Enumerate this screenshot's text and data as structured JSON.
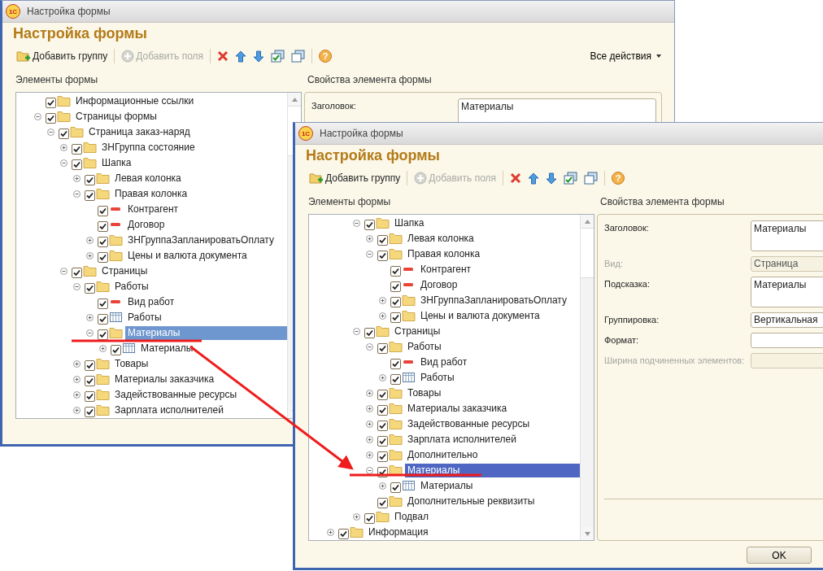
{
  "windows": [
    {
      "logo": "1С",
      "title": "Настройка формы",
      "heading": "Настройка формы",
      "focused": false,
      "toolbar": [
        [
          {
            "kind": "add-group",
            "label": "Добавить группу",
            "disabled": false
          }
        ],
        [
          {
            "kind": "add-fields",
            "label": "Добавить поля",
            "disabled": true
          }
        ],
        [
          {
            "kind": "delete"
          },
          {
            "kind": "up"
          },
          {
            "kind": "down"
          },
          {
            "kind": "check-all"
          },
          {
            "kind": "uncheck-all"
          }
        ],
        [
          {
            "kind": "help",
            "glyph": "?"
          }
        ]
      ],
      "all_actions": "Все действия",
      "tree_title": "Элементы формы",
      "tree": [
        {
          "label": "Информационные ссылки",
          "kind": "folder",
          "checked": true,
          "selected": false
        },
        {
          "label": "Страницы формы",
          "kind": "folder",
          "checked": true,
          "selected": false,
          "expanded": true,
          "children": [
            {
              "label": "Страница заказ-наряд",
              "kind": "folder",
              "checked": true,
              "selected": false,
              "expanded": true,
              "children": [
                {
                  "label": "ЗНГруппа состояние",
                  "kind": "folder",
                  "checked": true,
                  "selected": false,
                  "expanded": false
                },
                {
                  "label": "Шапка",
                  "kind": "folder",
                  "checked": true,
                  "selected": false,
                  "expanded": true,
                  "children": [
                    {
                      "label": "Левая колонка",
                      "kind": "folder",
                      "checked": true,
                      "selected": false,
                      "expanded": false
                    },
                    {
                      "label": "Правая колонка",
                      "kind": "folder",
                      "checked": true,
                      "selected": false,
                      "expanded": true,
                      "children": [
                        {
                          "label": "Контрагент",
                          "kind": "field",
                          "checked": true,
                          "selected": false
                        },
                        {
                          "label": "Договор",
                          "kind": "field",
                          "checked": true,
                          "selected": false
                        },
                        {
                          "label": "ЗНГруппаЗапланироватьОплату",
                          "kind": "folder",
                          "checked": true,
                          "selected": false,
                          "expanded": false
                        },
                        {
                          "label": "Цены и валюта документа",
                          "kind": "folder",
                          "checked": true,
                          "selected": false,
                          "expanded": false
                        }
                      ]
                    }
                  ]
                },
                {
                  "label": "Страницы",
                  "kind": "folder",
                  "checked": true,
                  "selected": false,
                  "expanded": true,
                  "children": [
                    {
                      "label": "Работы",
                      "kind": "folder",
                      "checked": true,
                      "selected": false,
                      "expanded": true,
                      "children": [
                        {
                          "label": "Вид работ",
                          "kind": "field",
                          "checked": true,
                          "selected": false
                        },
                        {
                          "label": "Работы",
                          "kind": "table",
                          "checked": true,
                          "selected": false,
                          "expanded": false
                        },
                        {
                          "label": "Материалы",
                          "kind": "folder",
                          "checked": true,
                          "selected": true,
                          "expanded": true,
                          "children": [
                            {
                              "label": "Материалы",
                              "kind": "table",
                              "checked": true,
                              "selected": false,
                              "expanded": false
                            }
                          ]
                        }
                      ]
                    },
                    {
                      "label": "Товары",
                      "kind": "folder",
                      "checked": true,
                      "selected": false,
                      "expanded": false
                    },
                    {
                      "label": "Материалы заказчика",
                      "kind": "folder",
                      "checked": true,
                      "selected": false,
                      "expanded": false
                    },
                    {
                      "label": "Задействованные ресурсы",
                      "kind": "folder",
                      "checked": true,
                      "selected": false,
                      "expanded": false
                    },
                    {
                      "label": "Зарплата исполнителей",
                      "kind": "folder",
                      "checked": true,
                      "selected": false,
                      "expanded": false
                    }
                  ]
                }
              ]
            }
          ]
        }
      ],
      "props_title": "Свойства элемента формы",
      "props": [
        {
          "label": "Заголовок:",
          "value": "Материалы",
          "kind": "multiline",
          "disabled": false
        }
      ]
    },
    {
      "logo": "1С",
      "title": "Настройка формы",
      "heading": "Настройка формы",
      "focused": true,
      "toolbar": [
        [
          {
            "kind": "add-group",
            "label": "Добавить группу",
            "disabled": false
          }
        ],
        [
          {
            "kind": "add-fields",
            "label": "Добавить поля",
            "disabled": true
          }
        ],
        [
          {
            "kind": "delete"
          },
          {
            "kind": "up"
          },
          {
            "kind": "down"
          },
          {
            "kind": "check-all"
          },
          {
            "kind": "uncheck-all"
          }
        ],
        [
          {
            "kind": "help",
            "glyph": "?"
          }
        ]
      ],
      "tree_title": "Элементы формы",
      "tree": [
        {
          "children": [
            {
              "children": [
                {
                  "label": "Шапка",
                  "kind": "folder",
                  "checked": true,
                  "selected": false,
                  "expanded": true,
                  "children": [
                    {
                      "label": "Левая колонка",
                      "kind": "folder",
                      "checked": true,
                      "selected": false,
                      "expanded": false
                    },
                    {
                      "label": "Правая колонка",
                      "kind": "folder",
                      "checked": true,
                      "selected": false,
                      "expanded": true,
                      "children": [
                        {
                          "label": "Контрагент",
                          "kind": "field",
                          "checked": true,
                          "selected": false
                        },
                        {
                          "label": "Договор",
                          "kind": "field",
                          "checked": true,
                          "selected": false
                        },
                        {
                          "label": "ЗНГруппаЗапланироватьОплату",
                          "kind": "folder",
                          "checked": true,
                          "selected": false,
                          "expanded": false
                        },
                        {
                          "label": "Цены и валюта документа",
                          "kind": "folder",
                          "checked": true,
                          "selected": false,
                          "expanded": false
                        }
                      ]
                    }
                  ]
                },
                {
                  "label": "Страницы",
                  "kind": "folder",
                  "checked": true,
                  "selected": false,
                  "expanded": true,
                  "children": [
                    {
                      "label": "Работы",
                      "kind": "folder",
                      "checked": true,
                      "selected": false,
                      "expanded": true,
                      "children": [
                        {
                          "label": "Вид работ",
                          "kind": "field",
                          "checked": true,
                          "selected": false
                        },
                        {
                          "label": "Работы",
                          "kind": "table",
                          "checked": true,
                          "selected": false,
                          "expanded": false
                        }
                      ]
                    },
                    {
                      "label": "Товары",
                      "kind": "folder",
                      "checked": true,
                      "selected": false,
                      "expanded": false
                    },
                    {
                      "label": "Материалы заказчика",
                      "kind": "folder",
                      "checked": true,
                      "selected": false,
                      "expanded": false
                    },
                    {
                      "label": "Задействованные ресурсы",
                      "kind": "folder",
                      "checked": true,
                      "selected": false,
                      "expanded": false
                    },
                    {
                      "label": "Зарплата исполнителей",
                      "kind": "folder",
                      "checked": true,
                      "selected": false,
                      "expanded": false
                    },
                    {
                      "label": "Дополнительно",
                      "kind": "folder",
                      "checked": true,
                      "selected": false,
                      "expanded": false
                    },
                    {
                      "label": "Материалы",
                      "kind": "folder",
                      "checked": true,
                      "selected": true,
                      "expanded": true,
                      "children": [
                        {
                          "label": "Материалы",
                          "kind": "table",
                          "checked": true,
                          "selected": false,
                          "expanded": false
                        }
                      ]
                    },
                    {
                      "label": "Дополнительные реквизиты",
                      "kind": "folder",
                      "checked": true,
                      "selected": false
                    }
                  ]
                },
                {
                  "label": "Подвал",
                  "kind": "folder",
                  "checked": true,
                  "selected": false,
                  "expanded": false
                }
              ]
            }
          ]
        },
        {
          "label": "Информация",
          "kind": "folder",
          "checked": true,
          "selected": false,
          "expanded": false
        }
      ],
      "props_title": "Свойства элемента формы",
      "props": [
        {
          "label": "Заголовок:",
          "value": "Материалы",
          "kind": "multiline",
          "disabled": false
        },
        {
          "label": "Вид:",
          "value": "Страница",
          "kind": "line",
          "disabled": true
        },
        {
          "label": "Подсказка:",
          "value": "Материалы",
          "kind": "multiline",
          "disabled": false
        },
        {
          "label": "Группировка:",
          "value": "Вертикальная",
          "kind": "line",
          "disabled": false
        },
        {
          "label": "Формат:",
          "kind": "line",
          "disabled": false
        },
        {
          "label": "Ширина подчиненных элементов:",
          "kind": "line",
          "disabled": true
        }
      ],
      "buttons": [
        "OK"
      ]
    }
  ]
}
